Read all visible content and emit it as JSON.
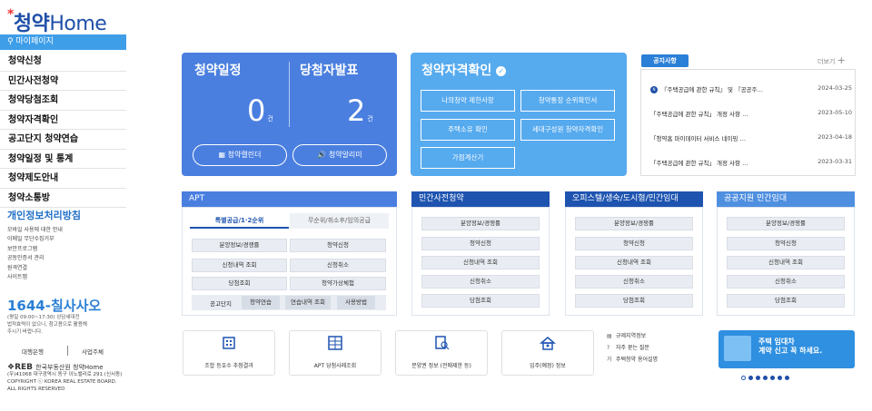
{
  "logo": {
    "star": "*",
    "brand_ko": "청약",
    "brand_en": "Home"
  },
  "mypage": "마이페이지",
  "nav": [
    "청약신청",
    "민간사전청약",
    "청약당첨조회",
    "청약자격확인",
    "공고단지 청약연습",
    "청약일정 및 통계",
    "청약제도안내",
    "청약소통방"
  ],
  "privacy": {
    "title": "개인정보처리방침",
    "links": [
      "모바일 사용에 대한 안내",
      "이메일 무단수집거부",
      "보안프로그램",
      "공동인증서 관리",
      "원격연결",
      "사이트맵"
    ]
  },
  "call": {
    "number": "1644-칠사사오",
    "info1": "(평일 09:00~17:30) 상담세대전",
    "info2": "법적효력이 없으니, 참고용으로 활용해",
    "info3": "주시기 바랍니다."
  },
  "side_buttons": {
    "left": "대행은행",
    "right": "사업주체"
  },
  "footer": {
    "org": "한국부동산원 청약Home",
    "addr": "(우)41068 대구광역시 동구 이노밸리로 291 (신서동)",
    "copyright": "COPYRIGHT ⓒ KOREA REAL ESTATE BOARD.",
    "rights": "ALL RIGHTS RESERVED"
  },
  "schedule": {
    "title1": "청약일정",
    "title2": "당첨자발표",
    "count1": "0",
    "count2": "2",
    "unit": "건",
    "btn1": "청약캘린더",
    "btn2": "청약알리미"
  },
  "qualify": {
    "title": "청약자격확인",
    "buttons": [
      "나의청약 제한사항",
      "청약통장 순위확인서",
      "주택소유 확인",
      "세대구성원 청약자격확인",
      "가점계산기"
    ]
  },
  "notice": {
    "tag": "공지사항",
    "more": "더보기",
    "items": [
      {
        "text": "『주택공급에 관한 규칙』 및 『공공주…",
        "date": "2024-03-25",
        "new": "N"
      },
      {
        "text": "「주택공급에 관한 규칙」 개정 사항 …",
        "date": "2023-05-10"
      },
      {
        "text": "「청약홈 마이데이터 서비스 네이밍 …",
        "date": "2023-04-18"
      },
      {
        "text": "「주택공급에 관한 규칙」 개정 사항 …",
        "date": "2023-03-31"
      }
    ]
  },
  "apt": {
    "title": "APT",
    "tab_active": "특별공급/1·2순위",
    "tab_inactive": "무순위/취소후/임의공급",
    "buttons": [
      "분양정보/경쟁률",
      "청약신청",
      "신청내역 조회",
      "신청취소",
      "당첨조회",
      "청약가상체험"
    ],
    "practice_label": "공고단지",
    "practice_btns": [
      "청약연습",
      "연습내역 조회",
      "사용방법"
    ]
  },
  "sections": [
    {
      "title": "민간사전청약",
      "color": "#1e54b0",
      "buttons": [
        "분양정보/경쟁률",
        "청약신청",
        "신청내역 조회",
        "신청취소",
        "당첨조회"
      ]
    },
    {
      "title": "오피스텔/생숙/도시형/민간임대",
      "color": "#1e54b0",
      "buttons": [
        "분양정보/경쟁률",
        "청약신청",
        "신청내역 조회",
        "신청취소",
        "당첨조회"
      ]
    },
    {
      "title": "공공지원 민간임대",
      "color": "#4f8fe0",
      "buttons": [
        "분양정보/경쟁률",
        "청약신청",
        "신청내역 조회",
        "신청취소",
        "당첨조회"
      ]
    }
  ],
  "bottom": [
    {
      "label": "조합 등호수 추첨결과",
      "icon": "building-icon"
    },
    {
      "label": "APT 당첨사례조회",
      "icon": "apartment-icon"
    },
    {
      "label": "분양권 정보 (전매제한 등)",
      "icon": "document-search-icon"
    },
    {
      "label": "입주(예정) 정보",
      "icon": "house-person-icon"
    }
  ],
  "links": [
    "규제지역정보",
    "자주 묻는 질문",
    "주택청약 용어설명"
  ],
  "banner": {
    "line1": "주택 임대차",
    "line2": "계약 신고 꼭 하세요."
  }
}
